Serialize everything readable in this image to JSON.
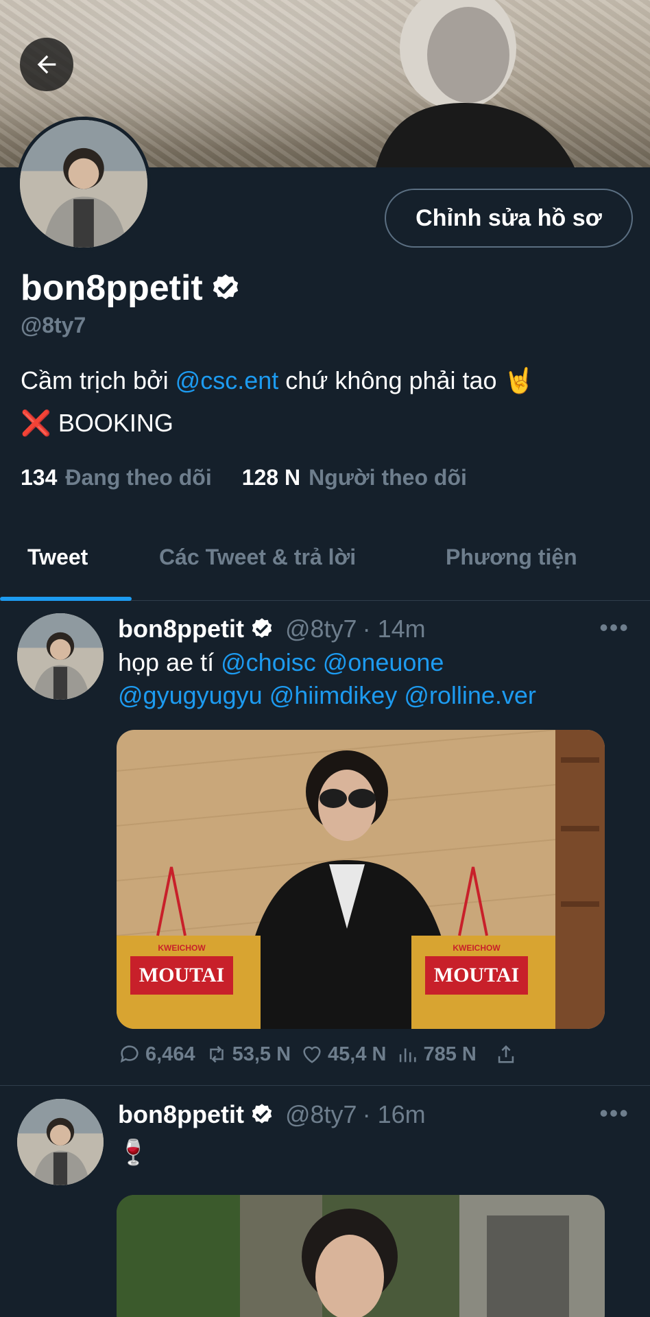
{
  "profile": {
    "display_name": "bon8ppetit",
    "handle": "@8ty7",
    "edit_label": "Chỉnh sửa hồ sơ",
    "bio_line1_prefix": "Cầm trịch bởi ",
    "bio_line1_mention": "@csc.ent",
    "bio_line1_suffix": " chứ không phải tao 🤘",
    "bio_line2_emoji": "❌",
    "bio_line2_text": " BOOKING",
    "following_count": "134",
    "following_label": "Đang theo dõi",
    "followers_count": "128 N",
    "followers_label": "Người theo dõi"
  },
  "tabs": [
    {
      "label": "Tweet"
    },
    {
      "label": "Các Tweet & trả lời"
    },
    {
      "label": "Phương tiện"
    }
  ],
  "tweets": [
    {
      "name": "bon8ppetit",
      "handle": "@8ty7",
      "time": "· 14m",
      "text_plain": "họp ae tí ",
      "mentions": [
        "@choisc",
        "@oneuone",
        "@gyugyugyu",
        "@hiimdikey",
        "@rolline.ver"
      ],
      "replies": "6,464",
      "retweets": "53,5 N",
      "likes": "45,4 N",
      "views": "785 N",
      "image_label": "MOUTAI",
      "image_brand": "KWEICHOW"
    },
    {
      "name": "bon8ppetit",
      "handle": "@8ty7",
      "time": "· 16m",
      "text_plain": "🍷"
    }
  ],
  "icons": {
    "back": "arrow-left-icon",
    "verified": "verified-badge-icon",
    "more": "more-horizontal-icon",
    "reply": "reply-icon",
    "retweet": "retweet-icon",
    "like": "heart-icon",
    "views": "views-icon",
    "share": "share-icon"
  },
  "colors": {
    "background": "#15202b",
    "accent": "#1d9bf0",
    "muted": "#6e7e8d",
    "divider": "#2f3e4c"
  },
  "more_glyph": "•••"
}
